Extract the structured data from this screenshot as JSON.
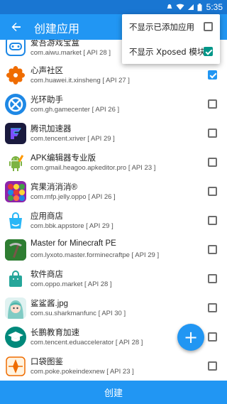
{
  "status_bar": {
    "time": "5:35",
    "icons": [
      "notification-icon",
      "wifi-icon",
      "signal-icon",
      "battery-icon"
    ]
  },
  "toolbar": {
    "title": "创建应用",
    "back_icon": "arrow-back-icon"
  },
  "popup_menu": {
    "items": [
      {
        "label": "不显示已添加应用",
        "checked": false
      },
      {
        "label": "不显示 Xposed 模块",
        "checked": true
      }
    ]
  },
  "apps": [
    {
      "name": "爱吾游戏宝盒",
      "package": "com.aiwu.market [ API 28 ]",
      "checked": false,
      "icon": "controller-icon",
      "icon_color": "#1e88e5"
    },
    {
      "name": "心声社区",
      "package": "com.huawei.it.xinsheng [ API 27 ]",
      "checked": true,
      "icon": "flower-icon",
      "icon_color": "#ef6c00"
    },
    {
      "name": "光环助手",
      "package": "com.gh.gamecenter [ API 26 ]",
      "checked": false,
      "icon": "halo-icon",
      "icon_color": "#1e88e5"
    },
    {
      "name": "腾讯加速器",
      "package": "com.tencent.xriver [ API 29 ]",
      "checked": false,
      "icon": "tencent-accelerator-icon",
      "icon_color": "#1a1a3e"
    },
    {
      "name": "APK编辑器专业版",
      "package": "com.gmail.heagoo.apkeditor.pro [ API 23 ]",
      "checked": false,
      "icon": "android-icon",
      "icon_color": "#7cb342"
    },
    {
      "name": "宾果消消消®",
      "package": "com.mfp.jelly.oppo [ API 26 ]",
      "checked": false,
      "icon": "candy-icon",
      "icon_color": "#8e24aa"
    },
    {
      "name": "应用商店",
      "package": "com.bbk.appstore [ API 29 ]",
      "checked": false,
      "icon": "shopping-bag-icon",
      "icon_color": "#29b6f6"
    },
    {
      "name": "Master for Minecraft PE",
      "package": "com.lyxoto.master.forminecraftpe [ API 29 ]",
      "checked": false,
      "icon": "pickaxe-icon",
      "icon_color": "#2e7d32"
    },
    {
      "name": "软件商店",
      "package": "com.oppo.market [ API 28 ]",
      "checked": false,
      "icon": "store-bag-icon",
      "icon_color": "#26a69a"
    },
    {
      "name": "鲨鲨酱.jpg",
      "package": "com.su.sharkmanfunc [ API 30 ]",
      "checked": false,
      "icon": "anime-avatar-icon",
      "icon_color": "#80cbc4"
    },
    {
      "name": "长鹏教育加速",
      "package": "com.tencent.eduaccelerator [ API 28 ]",
      "checked": false,
      "icon": "graduation-cap-icon",
      "icon_color": "#00897b"
    },
    {
      "name": "口袋图鉴",
      "package": "com.poke.pokeindexnew [ API 23 ]",
      "checked": false,
      "icon": "pokeball-icon",
      "icon_color": "#ef6c00"
    }
  ],
  "fab": {
    "label": "+",
    "icon": "add-icon"
  },
  "create_button": {
    "label": "创建"
  },
  "colors": {
    "primary": "#2196f3",
    "status_bar": "#1976d2",
    "accent": "#009688"
  }
}
